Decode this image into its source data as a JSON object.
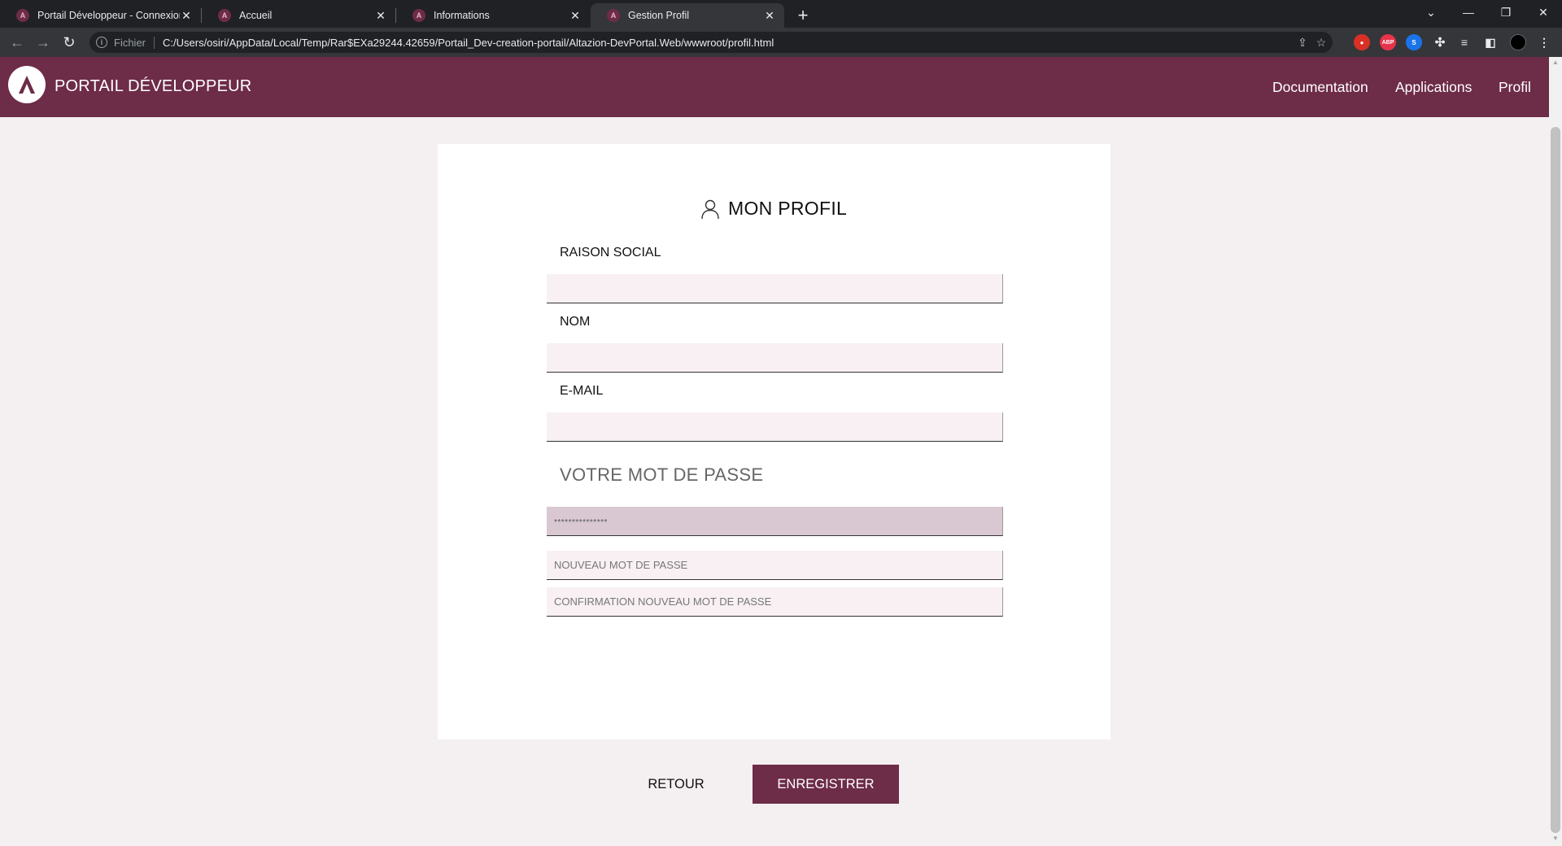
{
  "browser": {
    "tabs": [
      {
        "title": "Portail Développeur - Connexion",
        "active": false
      },
      {
        "title": "Accueil",
        "active": false
      },
      {
        "title": "Informations",
        "active": false
      },
      {
        "title": "Gestion Profil",
        "active": true
      }
    ],
    "address": {
      "scheme_label": "Fichier",
      "url": "C:/Users/osiri/AppData/Local/Temp/Rar$EXa29244.42659/Portail_Dev-creation-portail/Altazion-DevPortal.Web/wwwroot/profil.html"
    },
    "extensions": [
      "acrobat-icon",
      "adblock-icon",
      "shazam-icon",
      "puzzle-icon",
      "reading-list-icon",
      "side-panel-icon",
      "profile-icon"
    ]
  },
  "header": {
    "brand": "PORTAIL DÉVELOPPEUR",
    "nav": [
      "Documentation",
      "Applications",
      "Profil"
    ],
    "accent_color": "#6d2c48"
  },
  "form": {
    "title": "MON PROFIL",
    "fields": [
      {
        "label": "RAISON SOCIAL",
        "value": ""
      },
      {
        "label": "NOM",
        "value": ""
      },
      {
        "label": "E-MAIL",
        "value": ""
      }
    ],
    "password_section": {
      "title": "VOTRE MOT DE PASSE",
      "current_placeholder": "***************",
      "new_placeholder": "NOUVEAU MOT DE PASSE",
      "confirm_placeholder": "CONFIRMATION NOUVEAU MOT DE PASSE"
    }
  },
  "actions": {
    "back_label": "RETOUR",
    "save_label": "ENREGISTRER"
  }
}
